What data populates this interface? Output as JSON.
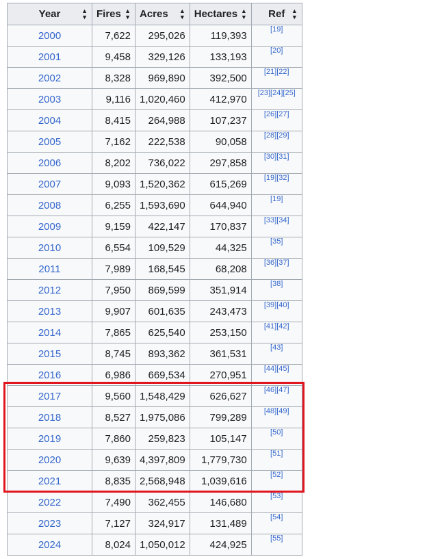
{
  "table": {
    "headers": [
      "Year",
      "Fires",
      "Acres",
      "Hectares",
      "Ref"
    ],
    "rows": [
      {
        "year": "2000",
        "fires": "7,622",
        "acres": "295,026",
        "hectares": "119,393",
        "ref": "[19]"
      },
      {
        "year": "2001",
        "fires": "9,458",
        "acres": "329,126",
        "hectares": "133,193",
        "ref": "[20]"
      },
      {
        "year": "2002",
        "fires": "8,328",
        "acres": "969,890",
        "hectares": "392,500",
        "ref": "[21][22]"
      },
      {
        "year": "2003",
        "fires": "9,116",
        "acres": "1,020,460",
        "hectares": "412,970",
        "ref": "[23][24][25]"
      },
      {
        "year": "2004",
        "fires": "8,415",
        "acres": "264,988",
        "hectares": "107,237",
        "ref": "[26][27]"
      },
      {
        "year": "2005",
        "fires": "7,162",
        "acres": "222,538",
        "hectares": "90,058",
        "ref": "[28][29]"
      },
      {
        "year": "2006",
        "fires": "8,202",
        "acres": "736,022",
        "hectares": "297,858",
        "ref": "[30][31]"
      },
      {
        "year": "2007",
        "fires": "9,093",
        "acres": "1,520,362",
        "hectares": "615,269",
        "ref": "[19][32]"
      },
      {
        "year": "2008",
        "fires": "6,255",
        "acres": "1,593,690",
        "hectares": "644,940",
        "ref": "[19]"
      },
      {
        "year": "2009",
        "fires": "9,159",
        "acres": "422,147",
        "hectares": "170,837",
        "ref": "[33][34]"
      },
      {
        "year": "2010",
        "fires": "6,554",
        "acres": "109,529",
        "hectares": "44,325",
        "ref": "[35]"
      },
      {
        "year": "2011",
        "fires": "7,989",
        "acres": "168,545",
        "hectares": "68,208",
        "ref": "[36][37]"
      },
      {
        "year": "2012",
        "fires": "7,950",
        "acres": "869,599",
        "hectares": "351,914",
        "ref": "[38]"
      },
      {
        "year": "2013",
        "fires": "9,907",
        "acres": "601,635",
        "hectares": "243,473",
        "ref": "[39][40]"
      },
      {
        "year": "2014",
        "fires": "7,865",
        "acres": "625,540",
        "hectares": "253,150",
        "ref": "[41][42]"
      },
      {
        "year": "2015",
        "fires": "8,745",
        "acres": "893,362",
        "hectares": "361,531",
        "ref": "[43]"
      },
      {
        "year": "2016",
        "fires": "6,986",
        "acres": "669,534",
        "hectares": "270,951",
        "ref": "[44][45]"
      },
      {
        "year": "2017",
        "fires": "9,560",
        "acres": "1,548,429",
        "hectares": "626,627",
        "ref": "[46][47]"
      },
      {
        "year": "2018",
        "fires": "8,527",
        "acres": "1,975,086",
        "hectares": "799,289",
        "ref": "[48][49]"
      },
      {
        "year": "2019",
        "fires": "7,860",
        "acres": "259,823",
        "hectares": "105,147",
        "ref": "[50]"
      },
      {
        "year": "2020",
        "fires": "9,639",
        "acres": "4,397,809",
        "hectares": "1,779,730",
        "ref": "[51]"
      },
      {
        "year": "2021",
        "fires": "8,835",
        "acres": "2,568,948",
        "hectares": "1,039,616",
        "ref": "[52]"
      },
      {
        "year": "2022",
        "fires": "7,490",
        "acres": "362,455",
        "hectares": "146,680",
        "ref": "[53]"
      },
      {
        "year": "2023",
        "fires": "7,127",
        "acres": "324,917",
        "hectares": "131,489",
        "ref": "[54]"
      },
      {
        "year": "2024",
        "fires": "8,024",
        "acres": "1,050,012",
        "hectares": "424,925",
        "ref": "[55]"
      }
    ]
  },
  "highlight": {
    "from_year": "2017",
    "to_year": "2021",
    "color": "#e0151e"
  },
  "colors": {
    "link": "#3366cc",
    "header_bg": "#eaecf0",
    "border": "#a2a9b1"
  },
  "icons": {
    "sort": "sort-arrows-icon"
  }
}
